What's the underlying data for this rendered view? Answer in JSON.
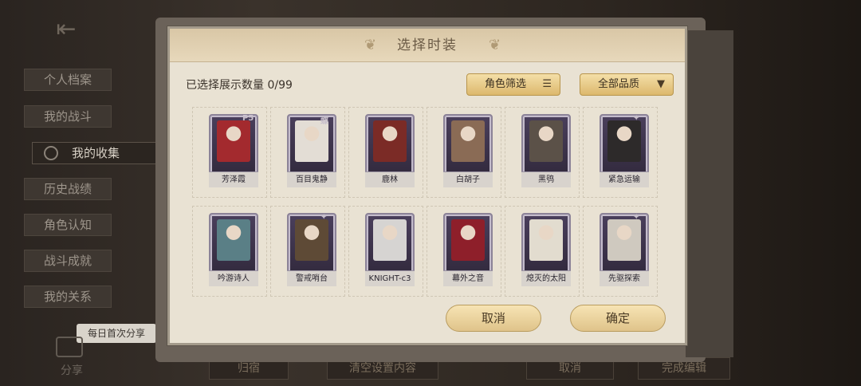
{
  "menu": {
    "items": [
      {
        "label": "个人档案",
        "active": false
      },
      {
        "label": "我的战斗",
        "active": false
      },
      {
        "label": "我的收集",
        "active": true
      },
      {
        "label": "历史战绩",
        "active": false
      },
      {
        "label": "角色认知",
        "active": false
      },
      {
        "label": "战斗成就",
        "active": false
      },
      {
        "label": "我的关系",
        "active": false
      }
    ],
    "share_tip": "每日首次分享",
    "share_label": "分享"
  },
  "background_buttons": {
    "b1": "归宿",
    "b2": "清空设置内容",
    "b3": "取消",
    "b4": "完成编辑"
  },
  "dialog": {
    "title": "选择时装",
    "selected_count": "已选择展示数量 0/99",
    "filter_role": "角色筛选",
    "filter_quality": "全部品质",
    "cancel": "取消",
    "confirm": "确定",
    "cards": [
      {
        "name": "芳泽霞",
        "badge": "P5",
        "tint": "#a32a2e"
      },
      {
        "name": "百目鬼静",
        "badge": "蝶",
        "tint": "#e3ddd5"
      },
      {
        "name": "鹿林",
        "badge": "",
        "tint": "#7b2b26"
      },
      {
        "name": "白胡子",
        "badge": "",
        "tint": "#8a6b55"
      },
      {
        "name": "黑鸮",
        "badge": "",
        "tint": "#5b5148"
      },
      {
        "name": "紧急运输",
        "badge": "✦",
        "tint": "#2d2a2a"
      },
      {
        "name": "吟游诗人",
        "badge": "",
        "tint": "#5a7f86"
      },
      {
        "name": "警戒哨台",
        "badge": "✦",
        "tint": "#5e4a36"
      },
      {
        "name": "KNIGHT-c3",
        "badge": "",
        "tint": "#d6d4d2"
      },
      {
        "name": "幕外之音",
        "badge": "",
        "tint": "#8e1f2a"
      },
      {
        "name": "熄灭的太阳",
        "badge": "",
        "tint": "#e2dccf"
      },
      {
        "name": "先驱探索",
        "badge": "✦",
        "tint": "#cfc9bf"
      }
    ]
  },
  "colors": {
    "dialog_bg": "#e9e2d3",
    "button_gold": "#dfc38a",
    "card_frame": "#4a3f5c"
  }
}
